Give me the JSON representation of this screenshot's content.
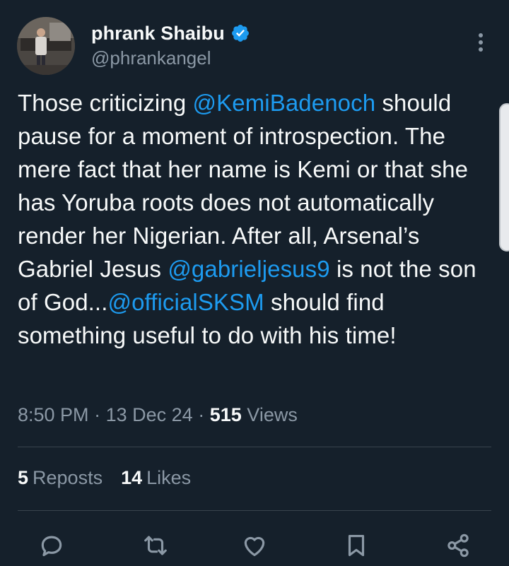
{
  "author": {
    "display_name": "phrank Shaibu",
    "handle": "@phrankangel",
    "verified": true
  },
  "tweet": {
    "segments": [
      {
        "text": "Those criticizing ",
        "type": "text"
      },
      {
        "text": "@KemiBadenoch",
        "type": "mention"
      },
      {
        "text": " should pause for a moment of introspection. The mere fact that her name is Kemi or that she has Yoruba roots does not automatically render her Nigerian. After all, Arsenal’s Gabriel Jesus ",
        "type": "text"
      },
      {
        "text": "@gabrieljesus9",
        "type": "mention"
      },
      {
        "text": " is not the son of God...",
        "type": "text"
      },
      {
        "text": "@officialSKSM",
        "type": "mention"
      },
      {
        "text": " should find something useful to do with his time!",
        "type": "text"
      }
    ]
  },
  "meta": {
    "time": "8:50 PM",
    "separator": "·",
    "date": "13 Dec 24",
    "views_count": "515",
    "views_label": "Views"
  },
  "stats": {
    "reposts_count": "5",
    "reposts_label": "Reposts",
    "likes_count": "14",
    "likes_label": "Likes"
  },
  "actions": {
    "reply_icon": "reply-icon",
    "repost_icon": "repost-icon",
    "like_icon": "heart-icon",
    "bookmark_icon": "bookmark-icon",
    "share_icon": "share-icon"
  },
  "colors": {
    "background": "#15202b",
    "text_primary": "#f7f9f9",
    "text_secondary": "#8b98a5",
    "accent": "#1d9bf0",
    "divider": "#38444d"
  }
}
